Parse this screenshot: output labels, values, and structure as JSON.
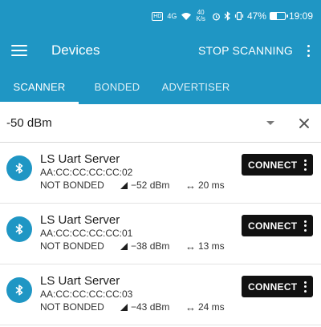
{
  "status_bar": {
    "network": "4G",
    "speed_value": "40",
    "speed_unit": "K/s",
    "battery": "47%",
    "battery_level": 0.47,
    "time": "19:09"
  },
  "appbar": {
    "title": "Devices",
    "stop_label": "STOP SCANNING",
    "menu_icon": "hamburger-menu-icon",
    "overflow_icon": "more-vert-icon"
  },
  "tabs": [
    {
      "label": "SCANNER",
      "active": true
    },
    {
      "label": "BONDED",
      "active": false
    },
    {
      "label": "ADVERTISER",
      "active": false
    }
  ],
  "filter": {
    "value": "-50 dBm"
  },
  "devices": [
    {
      "name": "LS Uart Server",
      "mac": "AA:CC:CC:CC:CC:02",
      "bond": "NOT BONDED",
      "rssi": "−52 dBm",
      "interval": "20 ms",
      "action": "CONNECT"
    },
    {
      "name": "LS Uart Server",
      "mac": "AA:CC:CC:CC:CC:01",
      "bond": "NOT BONDED",
      "rssi": "−38 dBm",
      "interval": "13 ms",
      "action": "CONNECT"
    },
    {
      "name": "LS Uart Server",
      "mac": "AA:CC:CC:CC:CC:03",
      "bond": "NOT BONDED",
      "rssi": "−43 dBm",
      "interval": "24 ms",
      "action": "CONNECT"
    }
  ],
  "colors": {
    "primary": "#1f96c4",
    "button": "#111111"
  }
}
